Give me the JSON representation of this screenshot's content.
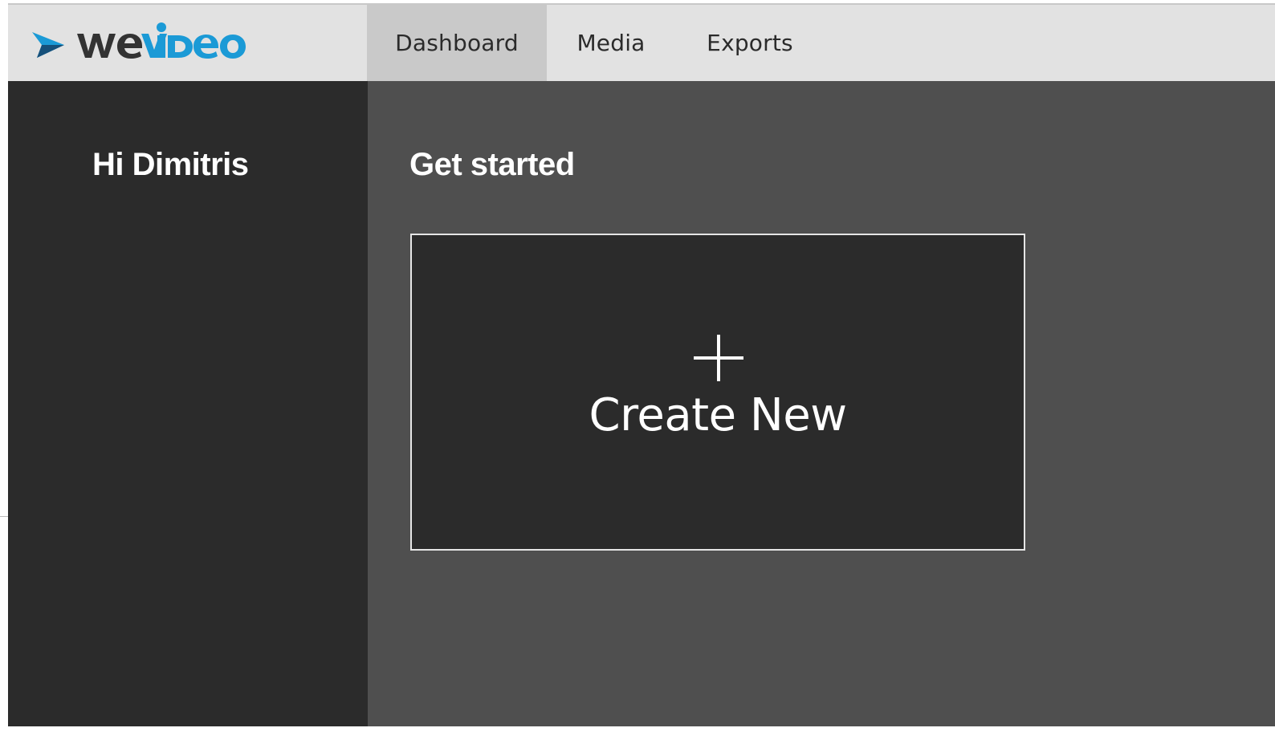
{
  "brand": {
    "logo_text": "weVideo",
    "accent_color": "#1b9ad6",
    "dark_color": "#333333"
  },
  "nav": {
    "tabs": [
      {
        "label": "Dashboard",
        "active": true
      },
      {
        "label": "Media",
        "active": false
      },
      {
        "label": "Exports",
        "active": false
      }
    ]
  },
  "sidebar": {
    "greeting": "Hi Dimitris"
  },
  "main": {
    "section_title": "Get started",
    "create_card": {
      "icon": "plus-icon",
      "label": "Create New"
    }
  }
}
